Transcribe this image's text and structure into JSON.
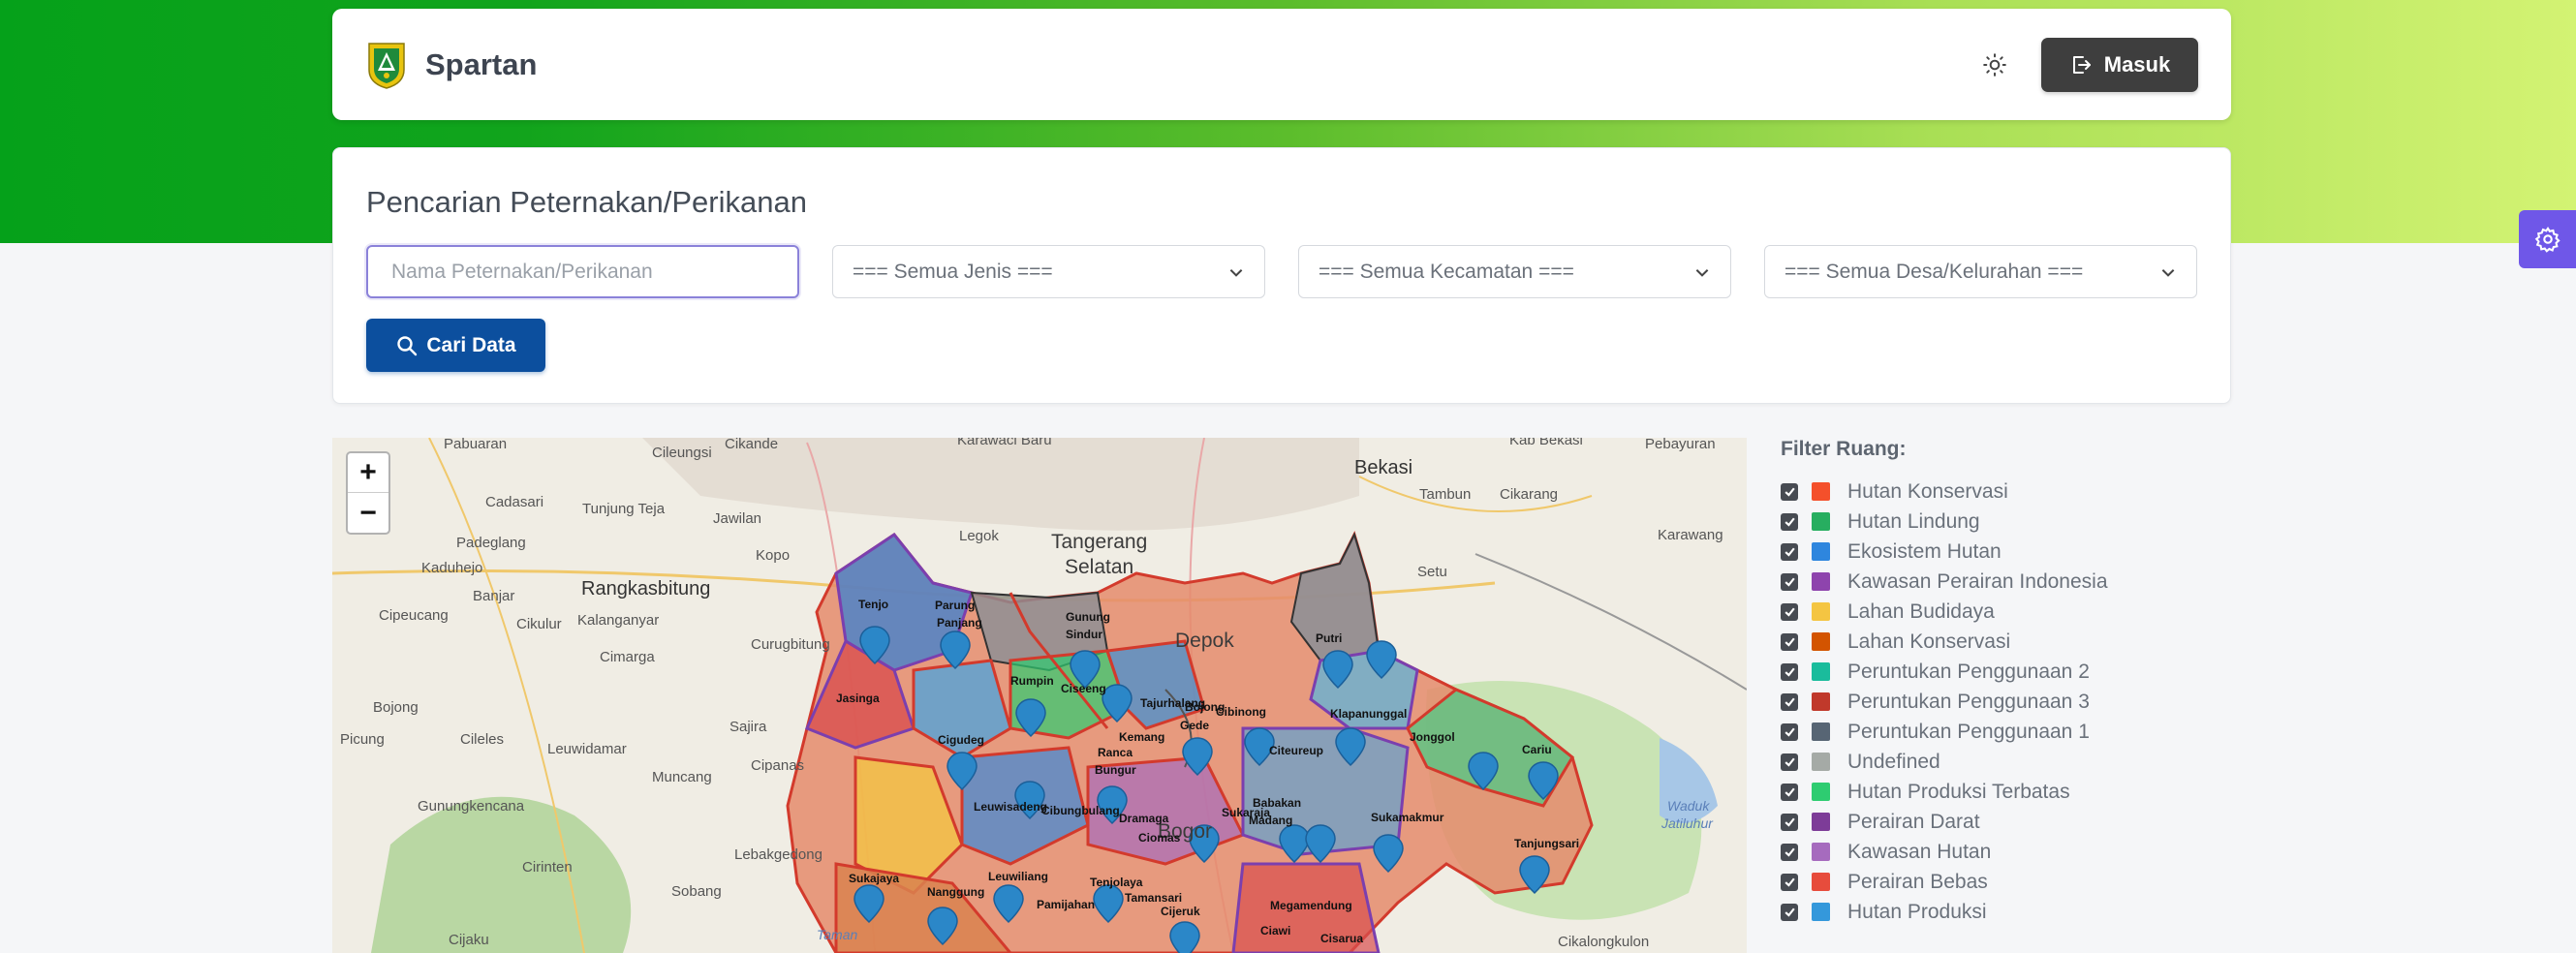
{
  "header": {
    "app_name": "Spartan",
    "login_label": "Masuk"
  },
  "search": {
    "title": "Pencarian Peternakan/Perikanan",
    "name_placeholder": "Nama Peternakan/Perikanan",
    "type_select": "=== Semua Jenis ===",
    "district_select": "=== Semua Kecamatan ===",
    "village_select": "=== Semua Desa/Kelurahan ===",
    "search_button": "Cari Data"
  },
  "map": {
    "zoom_in": "+",
    "zoom_out": "−",
    "labels": [
      "Pabuaran",
      "Cikande",
      "Karawaci Baru",
      "Kab Bekasi",
      "Pebayuran",
      "Cileungsi",
      "Cadasari",
      "Tunjung Teja",
      "Jawilan",
      "Tambun",
      "Cikarang",
      "Padeglang",
      "Kopo",
      "Legok",
      "Tangerang",
      "Selatan",
      "Karawang",
      "Kaduhejo",
      "Rangkasbitung",
      "Banjar",
      "Setu",
      "Cipeucang",
      "Cikulur",
      "Kalanganyar",
      "Curugbitung",
      "Depok",
      "Cimarga",
      "Bogor",
      "Bojong",
      "Sajira",
      "Cileles",
      "Leuwidamar",
      "Cipanas",
      "Picung",
      "Muncang",
      "Gunungkencana",
      "Lebakgedong",
      "Cirinten",
      "Sobang",
      "Cijaku",
      "Cikalongkulon",
      "Bekasi",
      "Taman",
      "Waduk",
      "Jatiluhur",
      "Tenjo",
      "Parung",
      "Panjang",
      "Gunung",
      "Sindur",
      "Rumpin",
      "Ciseeng",
      "Jasinga",
      "Cigudeg",
      "Tajurhalang",
      "Bojong",
      "Gede",
      "Cibinong",
      "Kemang",
      "Ranca",
      "Bungur",
      "Putri",
      "Klapanunggal",
      "Jonggol",
      "Citeureup",
      "Cariu",
      "Leuwisadeng",
      "Cibungbulang",
      "Dramaga",
      "Ciomas",
      "Sukaraja",
      "Babakan",
      "Madang",
      "Sukamakmur",
      "Tanjungsari",
      "Sukajaya",
      "Nanggung",
      "Leuwiliang",
      "Pamijahan",
      "Tenjolaya",
      "Tamansari",
      "Cijeruk",
      "Megamendung",
      "Ciawi",
      "Cisarua"
    ]
  },
  "filter_panel": {
    "title": "Filter Ruang:",
    "items": [
      {
        "label": "Hutan Konservasi",
        "color": "#f4502b"
      },
      {
        "label": "Hutan Lindung",
        "color": "#27ae60"
      },
      {
        "label": "Ekosistem Hutan",
        "color": "#2e86de"
      },
      {
        "label": "Kawasan Perairan Indonesia",
        "color": "#8e44ad"
      },
      {
        "label": "Lahan Budidaya",
        "color": "#f4c542"
      },
      {
        "label": "Lahan Konservasi",
        "color": "#d35400"
      },
      {
        "label": "Peruntukan Penggunaan 2",
        "color": "#1abc9c"
      },
      {
        "label": "Peruntukan Penggunaan 3",
        "color": "#c0392b"
      },
      {
        "label": "Peruntukan Penggunaan 1",
        "color": "#576574"
      },
      {
        "label": "Undefined",
        "color": "#a5aaa6"
      },
      {
        "label": "Hutan Produksi Terbatas",
        "color": "#2ecc71"
      },
      {
        "label": "Perairan Darat",
        "color": "#7d3c98"
      },
      {
        "label": "Kawasan Hutan",
        "color": "#a66bbe"
      },
      {
        "label": "Perairan Bebas",
        "color": "#e74c3c"
      },
      {
        "label": "Hutan Produksi",
        "color": "#3498db"
      }
    ]
  }
}
